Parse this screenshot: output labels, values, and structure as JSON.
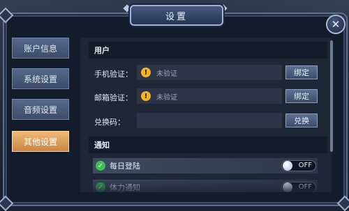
{
  "dialog": {
    "title": "设置",
    "close_icon": "close-icon"
  },
  "tabs": [
    {
      "label": "账户信息",
      "active": false
    },
    {
      "label": "系统设置",
      "active": false
    },
    {
      "label": "音频设置",
      "active": false
    },
    {
      "label": "其他设置",
      "active": true
    }
  ],
  "user_section": {
    "header": "用户",
    "phone": {
      "label": "手机验证：",
      "status": "未验证",
      "button": "绑定",
      "icon": "warning-icon"
    },
    "email": {
      "label": "邮箱验证：",
      "status": "未验证",
      "button": "绑定",
      "icon": "warning-icon"
    },
    "redeem": {
      "label": "兑换码：",
      "value": "",
      "button": "兑换"
    }
  },
  "notify_section": {
    "header": "通知",
    "items": [
      {
        "label": "每日登陆",
        "state": "OFF",
        "checked": true
      },
      {
        "label": "体力通知",
        "state": "OFF",
        "checked": true
      }
    ]
  },
  "colors": {
    "active_tab": "#e0a05e",
    "warning": "#f1b224",
    "check": "#3cbf55"
  }
}
